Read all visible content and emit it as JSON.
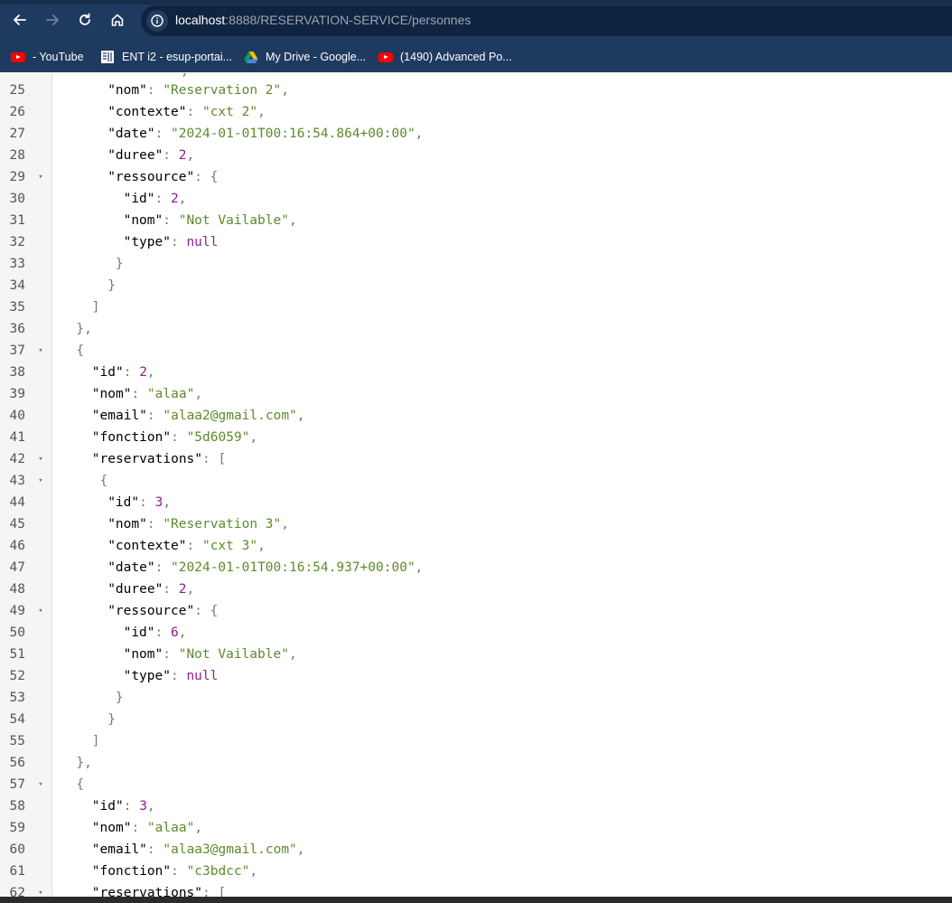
{
  "browser": {
    "url_host": "localhost",
    "url_rest": ":8888/RESERVATION-SERVICE/personnes",
    "nav_icons": [
      "back-arrow-icon",
      "forward-arrow-icon",
      "reload-icon",
      "home-icon",
      "info-icon"
    ],
    "colors": {
      "toolbar": "#1f3a5f",
      "address_bar": "#0f2440"
    }
  },
  "bookmarks": [
    {
      "label": "- YouTube",
      "icon": "youtube-icon"
    },
    {
      "label": "ENT i2 - esup-portai...",
      "icon": "ent-icon"
    },
    {
      "label": "My Drive - Google...",
      "icon": "google-drive-icon"
    },
    {
      "label": "(1490) Advanced Po...",
      "icon": "youtube-icon"
    }
  ],
  "json_view": {
    "colors": {
      "key": "#000000",
      "string": "#5e8a2b",
      "number": "#8b1f8b",
      "punctuation": "#777777"
    },
    "lines": [
      {
        "n": "25",
        "fold": "",
        "indent": 6,
        "tokens": [
          [
            "k",
            "\"nom\""
          ],
          [
            "p",
            ": "
          ],
          [
            "s",
            "\"Reservation 2\""
          ],
          [
            "p",
            ","
          ]
        ]
      },
      {
        "n": "26",
        "fold": "",
        "indent": 6,
        "tokens": [
          [
            "k",
            "\"contexte\""
          ],
          [
            "p",
            ": "
          ],
          [
            "s",
            "\"cxt 2\""
          ],
          [
            "p",
            ","
          ]
        ]
      },
      {
        "n": "27",
        "fold": "",
        "indent": 6,
        "tokens": [
          [
            "k",
            "\"date\""
          ],
          [
            "p",
            ": "
          ],
          [
            "s",
            "\"2024-01-01T00:16:54.864+00:00\""
          ],
          [
            "p",
            ","
          ]
        ]
      },
      {
        "n": "28",
        "fold": "",
        "indent": 6,
        "tokens": [
          [
            "k",
            "\"duree\""
          ],
          [
            "p",
            ": "
          ],
          [
            "n",
            "2"
          ],
          [
            "p",
            ","
          ]
        ]
      },
      {
        "n": "29",
        "fold": "▾",
        "indent": 6,
        "tokens": [
          [
            "k",
            "\"ressource\""
          ],
          [
            "p",
            ": {"
          ]
        ]
      },
      {
        "n": "30",
        "fold": "",
        "indent": 8,
        "tokens": [
          [
            "k",
            "\"id\""
          ],
          [
            "p",
            ": "
          ],
          [
            "n",
            "2"
          ],
          [
            "p",
            ","
          ]
        ]
      },
      {
        "n": "31",
        "fold": "",
        "indent": 8,
        "tokens": [
          [
            "k",
            "\"nom\""
          ],
          [
            "p",
            ": "
          ],
          [
            "s",
            "\"Not Vailable\""
          ],
          [
            "p",
            ","
          ]
        ]
      },
      {
        "n": "32",
        "fold": "",
        "indent": 8,
        "tokens": [
          [
            "k",
            "\"type\""
          ],
          [
            "p",
            ": "
          ],
          [
            "nl",
            "null"
          ]
        ]
      },
      {
        "n": "33",
        "fold": "",
        "indent": 7,
        "tokens": [
          [
            "p",
            "}"
          ]
        ]
      },
      {
        "n": "34",
        "fold": "",
        "indent": 6,
        "tokens": [
          [
            "p",
            "}"
          ]
        ]
      },
      {
        "n": "35",
        "fold": "",
        "indent": 4,
        "tokens": [
          [
            "p",
            "]"
          ]
        ]
      },
      {
        "n": "36",
        "fold": "",
        "indent": 2,
        "tokens": [
          [
            "p",
            "},"
          ]
        ]
      },
      {
        "n": "37",
        "fold": "▾",
        "indent": 2,
        "tokens": [
          [
            "p",
            "{"
          ]
        ]
      },
      {
        "n": "38",
        "fold": "",
        "indent": 4,
        "tokens": [
          [
            "k",
            "\"id\""
          ],
          [
            "p",
            ": "
          ],
          [
            "n",
            "2"
          ],
          [
            "p",
            ","
          ]
        ]
      },
      {
        "n": "39",
        "fold": "",
        "indent": 4,
        "tokens": [
          [
            "k",
            "\"nom\""
          ],
          [
            "p",
            ": "
          ],
          [
            "s",
            "\"alaa\""
          ],
          [
            "p",
            ","
          ]
        ]
      },
      {
        "n": "40",
        "fold": "",
        "indent": 4,
        "tokens": [
          [
            "k",
            "\"email\""
          ],
          [
            "p",
            ": "
          ],
          [
            "s",
            "\"alaa2@gmail.com\""
          ],
          [
            "p",
            ","
          ]
        ]
      },
      {
        "n": "41",
        "fold": "",
        "indent": 4,
        "tokens": [
          [
            "k",
            "\"fonction\""
          ],
          [
            "p",
            ": "
          ],
          [
            "s",
            "\"5d6059\""
          ],
          [
            "p",
            ","
          ]
        ]
      },
      {
        "n": "42",
        "fold": "▾",
        "indent": 4,
        "tokens": [
          [
            "k",
            "\"reservations\""
          ],
          [
            "p",
            ": ["
          ]
        ]
      },
      {
        "n": "43",
        "fold": "▾",
        "indent": 5,
        "tokens": [
          [
            "p",
            "{"
          ]
        ]
      },
      {
        "n": "44",
        "fold": "",
        "indent": 6,
        "tokens": [
          [
            "k",
            "\"id\""
          ],
          [
            "p",
            ": "
          ],
          [
            "n",
            "3"
          ],
          [
            "p",
            ","
          ]
        ]
      },
      {
        "n": "45",
        "fold": "",
        "indent": 6,
        "tokens": [
          [
            "k",
            "\"nom\""
          ],
          [
            "p",
            ": "
          ],
          [
            "s",
            "\"Reservation 3\""
          ],
          [
            "p",
            ","
          ]
        ]
      },
      {
        "n": "46",
        "fold": "",
        "indent": 6,
        "tokens": [
          [
            "k",
            "\"contexte\""
          ],
          [
            "p",
            ": "
          ],
          [
            "s",
            "\"cxt 3\""
          ],
          [
            "p",
            ","
          ]
        ]
      },
      {
        "n": "47",
        "fold": "",
        "indent": 6,
        "tokens": [
          [
            "k",
            "\"date\""
          ],
          [
            "p",
            ": "
          ],
          [
            "s",
            "\"2024-01-01T00:16:54.937+00:00\""
          ],
          [
            "p",
            ","
          ]
        ]
      },
      {
        "n": "48",
        "fold": "",
        "indent": 6,
        "tokens": [
          [
            "k",
            "\"duree\""
          ],
          [
            "p",
            ": "
          ],
          [
            "n",
            "2"
          ],
          [
            "p",
            ","
          ]
        ]
      },
      {
        "n": "49",
        "fold": "▾",
        "indent": 6,
        "tokens": [
          [
            "k",
            "\"ressource\""
          ],
          [
            "p",
            ": {"
          ]
        ]
      },
      {
        "n": "50",
        "fold": "",
        "indent": 8,
        "tokens": [
          [
            "k",
            "\"id\""
          ],
          [
            "p",
            ": "
          ],
          [
            "n",
            "6"
          ],
          [
            "p",
            ","
          ]
        ]
      },
      {
        "n": "51",
        "fold": "",
        "indent": 8,
        "tokens": [
          [
            "k",
            "\"nom\""
          ],
          [
            "p",
            ": "
          ],
          [
            "s",
            "\"Not Vailable\""
          ],
          [
            "p",
            ","
          ]
        ]
      },
      {
        "n": "52",
        "fold": "",
        "indent": 8,
        "tokens": [
          [
            "k",
            "\"type\""
          ],
          [
            "p",
            ": "
          ],
          [
            "nl",
            "null"
          ]
        ]
      },
      {
        "n": "53",
        "fold": "",
        "indent": 7,
        "tokens": [
          [
            "p",
            "}"
          ]
        ]
      },
      {
        "n": "54",
        "fold": "",
        "indent": 6,
        "tokens": [
          [
            "p",
            "}"
          ]
        ]
      },
      {
        "n": "55",
        "fold": "",
        "indent": 4,
        "tokens": [
          [
            "p",
            "]"
          ]
        ]
      },
      {
        "n": "56",
        "fold": "",
        "indent": 2,
        "tokens": [
          [
            "p",
            "},"
          ]
        ]
      },
      {
        "n": "57",
        "fold": "▾",
        "indent": 2,
        "tokens": [
          [
            "p",
            "{"
          ]
        ]
      },
      {
        "n": "58",
        "fold": "",
        "indent": 4,
        "tokens": [
          [
            "k",
            "\"id\""
          ],
          [
            "p",
            ": "
          ],
          [
            "n",
            "3"
          ],
          [
            "p",
            ","
          ]
        ]
      },
      {
        "n": "59",
        "fold": "",
        "indent": 4,
        "tokens": [
          [
            "k",
            "\"nom\""
          ],
          [
            "p",
            ": "
          ],
          [
            "s",
            "\"alaa\""
          ],
          [
            "p",
            ","
          ]
        ]
      },
      {
        "n": "60",
        "fold": "",
        "indent": 4,
        "tokens": [
          [
            "k",
            "\"email\""
          ],
          [
            "p",
            ": "
          ],
          [
            "s",
            "\"alaa3@gmail.com\""
          ],
          [
            "p",
            ","
          ]
        ]
      },
      {
        "n": "61",
        "fold": "",
        "indent": 4,
        "tokens": [
          [
            "k",
            "\"fonction\""
          ],
          [
            "p",
            ": "
          ],
          [
            "s",
            "\"c3bdcc\""
          ],
          [
            "p",
            ","
          ]
        ]
      },
      {
        "n": "62",
        "fold": "▾",
        "indent": 4,
        "tokens": [
          [
            "k",
            "\"reservations\""
          ],
          [
            "p",
            ": ["
          ]
        ]
      }
    ]
  }
}
